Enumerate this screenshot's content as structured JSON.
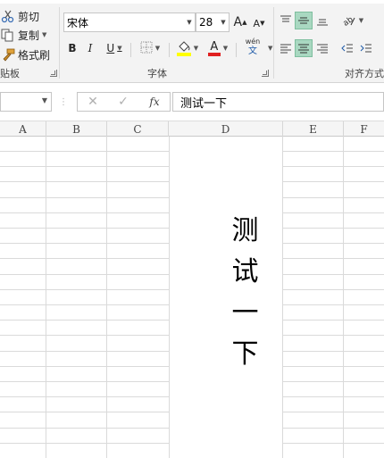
{
  "ribbon": {
    "clipboard": {
      "cut_label": "剪切",
      "copy_label": "复制",
      "format_painter_label": "格式刷",
      "group_label": "贴板"
    },
    "font": {
      "font_name": "宋体",
      "font_size": "28",
      "bold": "B",
      "italic": "I",
      "underline": "U",
      "grow": "A",
      "shrink": "A",
      "font_color_letter": "A",
      "phonetic_top": "wén",
      "phonetic_bottom": "文",
      "group_label": "字体",
      "fill_color": "#ffff00",
      "font_color": "#e02020"
    },
    "alignment": {
      "group_label": "对齐方式",
      "selected_color": "#a9d8c1"
    }
  },
  "formula_bar": {
    "cancel_symbol": "✕",
    "enter_symbol": "✓",
    "fx_symbol": "fx",
    "content": "测试一下"
  },
  "columns": [
    "A",
    "B",
    "C",
    "D",
    "E",
    "F"
  ],
  "cell_text_chars": [
    "测",
    "试",
    "一",
    "下"
  ]
}
